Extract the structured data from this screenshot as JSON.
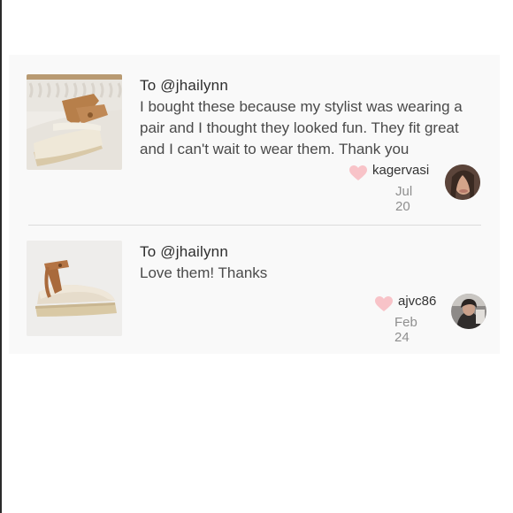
{
  "reviews": [
    {
      "to": "To @jhailynn",
      "text": "I bought these because my stylist was wearing a pair and I thought they looked fun. They fit great and I can't wait to wear them. Thank you",
      "user": "kagervasi",
      "date": "Jul 20",
      "icons": {
        "like": "heart-icon",
        "avatar": "user-avatar"
      }
    },
    {
      "to": "To @jhailynn",
      "text": "Love them! Thanks",
      "user": "ajvc86",
      "date": "Feb 24",
      "icons": {
        "like": "heart-icon",
        "avatar": "user-avatar"
      }
    }
  ],
  "colors": {
    "heart": "#f8c3c8",
    "card_background": "#f9f9f9",
    "divider": "#dcdcdc",
    "secondary_text": "#8f8f8f"
  }
}
